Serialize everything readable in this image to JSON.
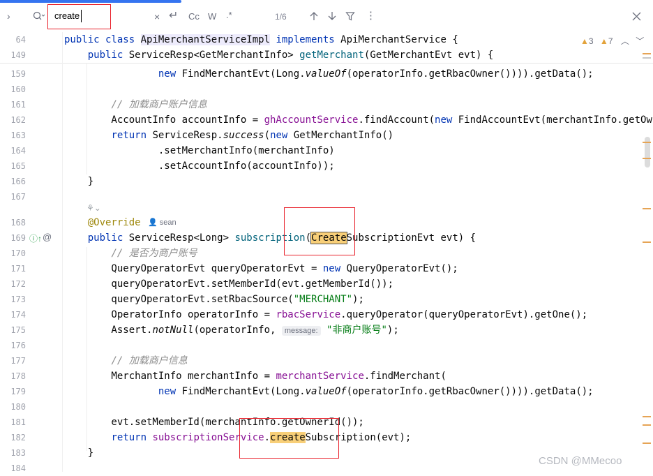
{
  "find_bar": {
    "query": "create",
    "match_case_label": "Cc",
    "words_label": "W",
    "regex_label": ".*",
    "result_count": "1/6",
    "icons": [
      "expand-icon",
      "search-history-icon",
      "clear-icon",
      "replace-toggle-icon",
      "prev-occurrence-icon",
      "next-occurrence-icon",
      "filter-icon",
      "more-icon",
      "close-icon"
    ]
  },
  "inspections": {
    "warnings": "3",
    "weak_warnings": "7"
  },
  "sticky": [
    {
      "line": "64",
      "text": "public class ApiMerchantServiceImpl implements ApiMerchantService {"
    },
    {
      "line": "149",
      "text": "public ServiceResp<GetMerchantInfo> getMerchant(GetMerchantEvt evt) {"
    }
  ],
  "code": {
    "l159": "159",
    "l160": "160",
    "l161": "161",
    "l162": "162",
    "l163": "163",
    "l164": "164",
    "l165": "165",
    "l166": "166",
    "l167": "167",
    "l168": "168",
    "l169": "169",
    "l170": "170",
    "l171": "171",
    "l172": "172",
    "l173": "173",
    "l174": "174",
    "l175": "175",
    "l176": "176",
    "l177": "177",
    "l178": "178",
    "l179": "179",
    "l180": "180",
    "l181": "181",
    "l182": "182",
    "l183": "183",
    "l184": "184",
    "comment_load_account": "// 加载商户账户信息",
    "comment_is_merchant": "// 是否为商户账号",
    "comment_load_merchant": "// 加载商户信息",
    "annotation_override": "@Override",
    "author": "sean",
    "hint_message": "message:",
    "string_merchant": "\"MERCHANT\"",
    "string_not_merchant": "\"非商户账号\""
  },
  "watermark": "CSDN @MMecoo",
  "colors": {
    "keyword": "#0033b3",
    "method": "#00627a",
    "field": "#871094",
    "string": "#067d17",
    "comment": "#8c8c8c",
    "annotation": "#9e880d",
    "match": "#f8cf78",
    "annotation_box": "#e8202a"
  }
}
